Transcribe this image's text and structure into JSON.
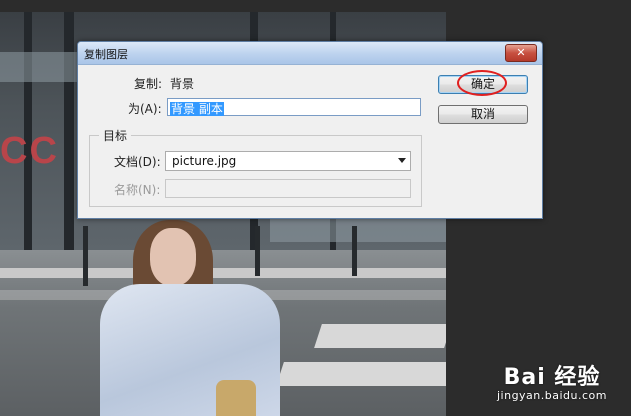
{
  "dialog": {
    "title": "复制图层",
    "close_icon": "close-icon",
    "copy_label": "复制:",
    "copy_value": "背景",
    "as_label": "为(A):",
    "as_value": "背景 副本",
    "target_group_title": "目标",
    "document_label": "文档(D):",
    "document_value": "picture.jpg",
    "name_label": "名称(N):",
    "name_value": "",
    "ok_label": "确定",
    "cancel_label": "取消"
  },
  "background": {
    "store_sign": "CC",
    "watermark_main": "Bai 经验",
    "watermark_sub": "jingyan.baidu.com"
  },
  "colors": {
    "highlight": "#3399ff",
    "annotation_circle": "#e02020",
    "close_button": "#c75040"
  }
}
